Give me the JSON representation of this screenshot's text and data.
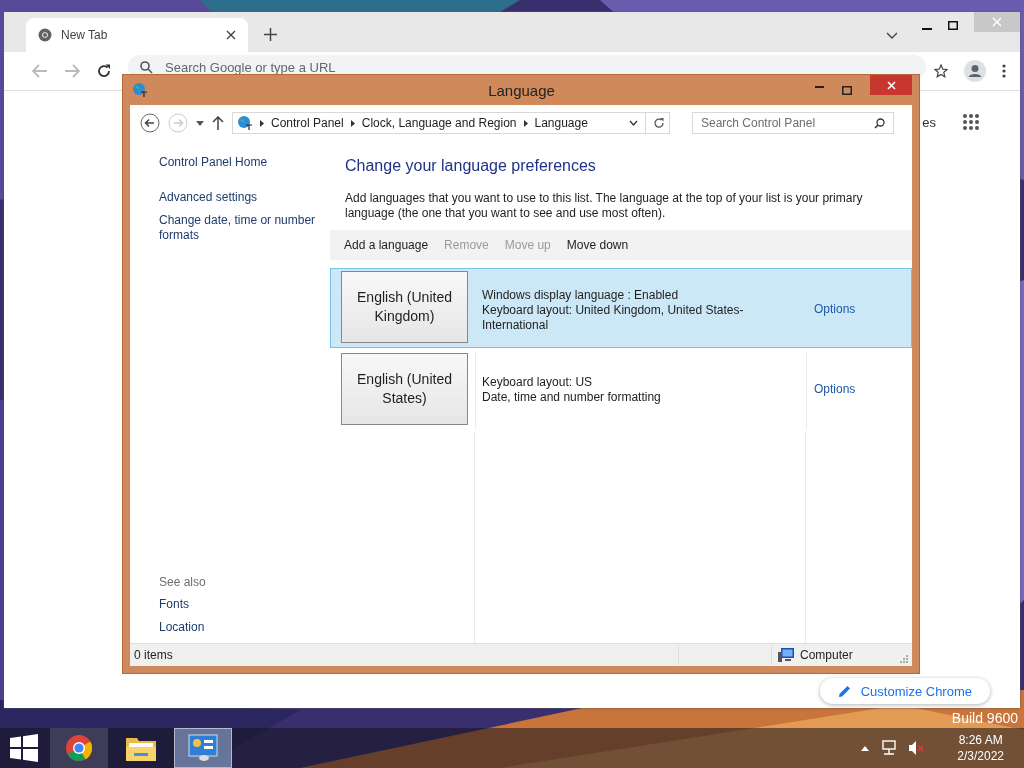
{
  "desktop": {
    "build_text": "Build 9600"
  },
  "browser": {
    "tab": {
      "title": "New Tab",
      "selected": true
    },
    "omnibox": {
      "placeholder": "Search Google or type a URL"
    },
    "partial_link": "es",
    "customize_button": "Customize Chrome"
  },
  "language_window": {
    "title": "Language",
    "breadcrumb": [
      "Control Panel",
      "Clock, Language and Region",
      "Language"
    ],
    "search": {
      "placeholder": "Search Control Panel"
    },
    "sidebar": {
      "items": [
        "Control Panel Home",
        "Advanced settings",
        "Change date, time or number formats"
      ],
      "see_also": {
        "label": "See also",
        "items": [
          "Fonts",
          "Location"
        ]
      }
    },
    "heading": "Change your language preferences",
    "description": "Add languages that you want to use to this list. The language at the top of your list is your primary language (the one that you want to see and use most often).",
    "toolbar": [
      {
        "label": "Add a language",
        "disabled": false
      },
      {
        "label": "Remove",
        "disabled": true
      },
      {
        "label": "Move up",
        "disabled": true
      },
      {
        "label": "Move down",
        "disabled": false
      }
    ],
    "languages": [
      {
        "name": "English (United Kingdom)",
        "details": [
          "Windows display language : Enabled",
          "Keyboard layout: United Kingdom, United States-International"
        ],
        "options": "Options",
        "selected": true
      },
      {
        "name": "English (United States)",
        "details": [
          "Keyboard layout: US",
          "Date, time and number formatting"
        ],
        "options": "Options",
        "selected": false
      }
    ],
    "status_bar": {
      "items": "0 items",
      "location": "Computer"
    }
  },
  "taskbar": {
    "apps": [
      {
        "kind": "chrome",
        "selected": false
      },
      {
        "kind": "explorer",
        "selected": false
      },
      {
        "kind": "control-panel",
        "selected": true
      }
    ],
    "clock": {
      "time": "8:26 AM",
      "date": "2/3/2022"
    }
  }
}
